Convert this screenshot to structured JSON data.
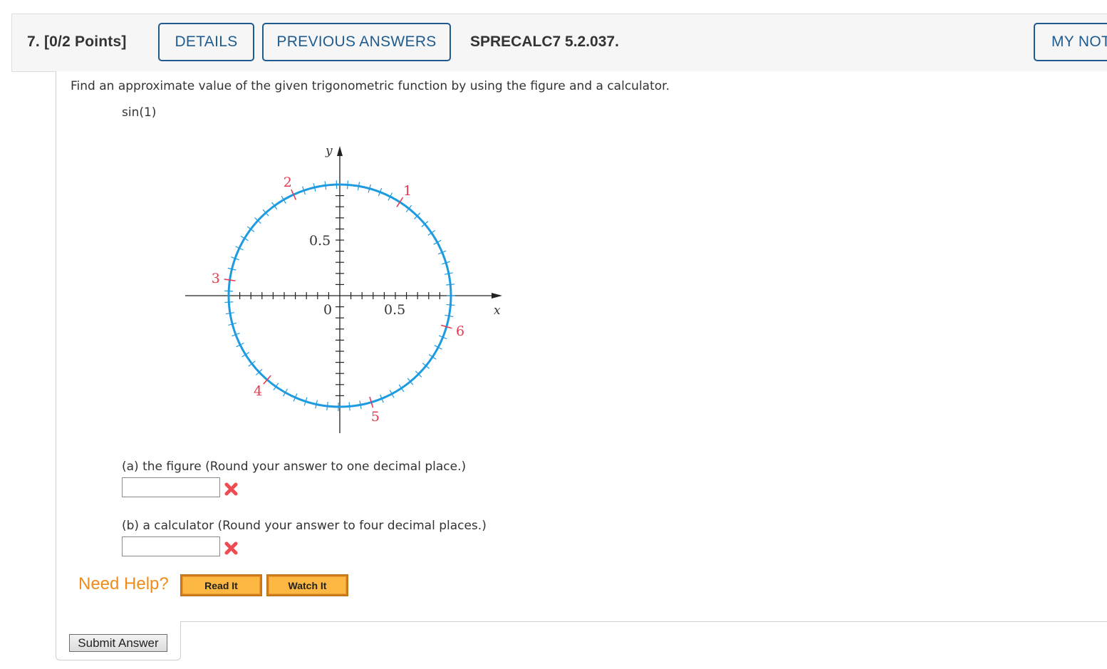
{
  "header": {
    "question_number": "7.",
    "points": "[0/2 Points]",
    "details_label": "DETAILS",
    "previous_answers_label": "PREVIOUS ANSWERS",
    "problem_code": "SPRECALC7 5.2.037.",
    "my_notes_label": "MY NOTES"
  },
  "question": {
    "prompt": "Find an approximate value of the given trigonometric function by using the figure and a calculator.",
    "function": "sin(1)",
    "figure": {
      "type": "unit-circle",
      "x_axis_label": "x",
      "y_axis_label": "y",
      "origin_label": "0",
      "x_tick_label": "0.5",
      "y_tick_label": "0.5",
      "radian_labels": [
        "1",
        "2",
        "3",
        "4",
        "5",
        "6"
      ],
      "circle_color": "#1e9be0",
      "radian_mark_color": "#e8384f"
    },
    "parts": [
      {
        "label": "(a) the figure (Round your answer to one decimal place.)",
        "value": "",
        "status": "incorrect",
        "status_icon": "x-mark-icon"
      },
      {
        "label": "(b) a calculator (Round your answer to four decimal places.)",
        "value": "",
        "status": "incorrect",
        "status_icon": "x-mark-icon"
      }
    ]
  },
  "help": {
    "label": "Need Help?",
    "read_it_label": "Read It",
    "watch_it_label": "Watch It"
  },
  "submit_label": "Submit Answer",
  "colors": {
    "accent": "#1f5b8e",
    "help": "#f08c1a",
    "help_button": "#fdb743",
    "error": "#e8384f"
  }
}
